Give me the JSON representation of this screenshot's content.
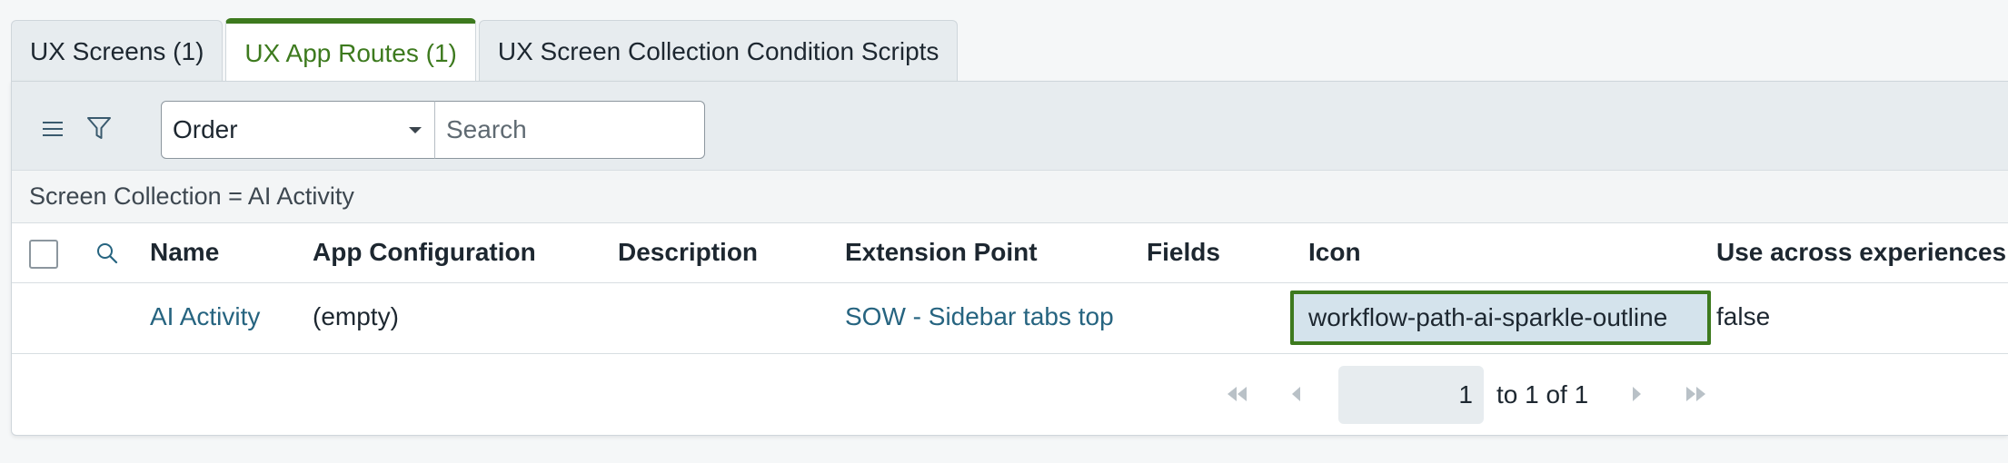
{
  "tabs": [
    {
      "label": "UX Screens (1)",
      "active": false
    },
    {
      "label": "UX App Routes (1)",
      "active": true
    },
    {
      "label": "UX Screen Collection Condition Scripts",
      "active": false
    }
  ],
  "toolbar": {
    "menu_icon": "hamburger-menu-icon",
    "filter_icon": "filter-funnel-icon",
    "field_select_value": "Order",
    "search_placeholder": "Search"
  },
  "breadcrumb": "Screen Collection = AI Activity",
  "table": {
    "columns": [
      "Name",
      "App Configuration",
      "Description",
      "Extension Point",
      "Fields",
      "Icon",
      "Use across experiences"
    ],
    "rows": [
      {
        "name": "AI Activity",
        "app_configuration": "(empty)",
        "description": "",
        "extension_point": "SOW - Sidebar tabs top",
        "fields": "",
        "icon": "workflow-path-ai-sparkle-outline",
        "use_across_experiences": "false"
      }
    ]
  },
  "pagination": {
    "current_page": "1",
    "range_text": "to 1 of 1"
  },
  "colors": {
    "accent": "#3d7a1e",
    "link": "#266480",
    "toolbar_bg": "#e7ecef",
    "selected_cell_bg": "#d4e3ec"
  }
}
